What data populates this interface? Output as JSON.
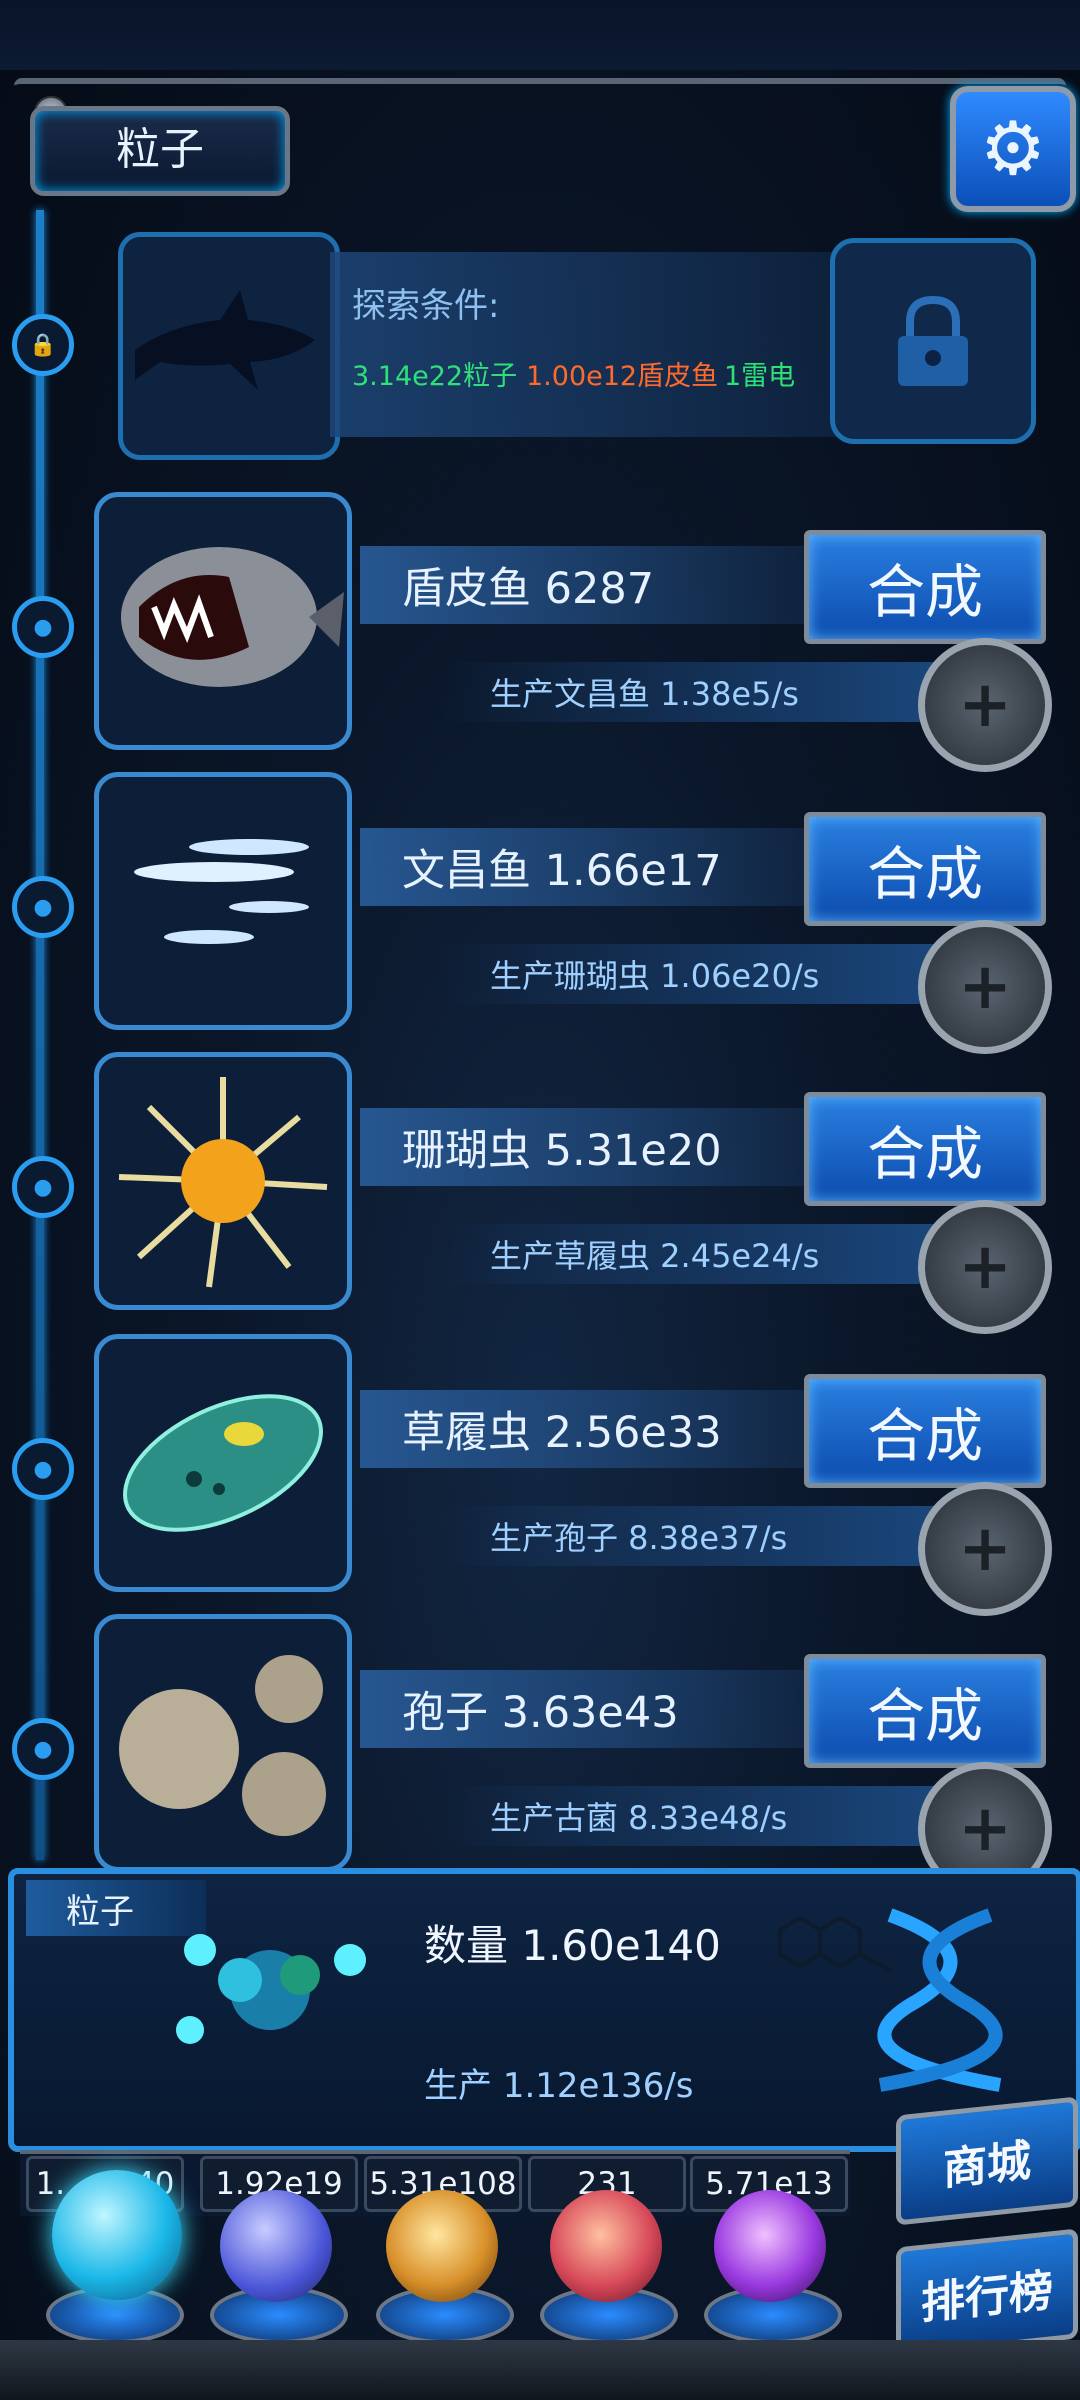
{
  "header": {
    "title": "粒子",
    "settings_icon": "gear-icon"
  },
  "locked": {
    "silhouette_icon": "shark-silhouette-icon",
    "condition_label": "探索条件:",
    "requirements": [
      {
        "text": "3.14e22粒子",
        "color": "#2ee07a"
      },
      {
        "text": "1.00e12盾皮鱼",
        "color": "#ff6a2b"
      },
      {
        "text": "1雷电",
        "color": "#2ee07a"
      }
    ],
    "lock_icon": "lock-icon"
  },
  "rows": [
    {
      "name": "盾皮鱼 6287",
      "production": "生产文昌鱼 1.38e5/s",
      "merge_label": "合成",
      "image": "armored-fish-icon"
    },
    {
      "name": "文昌鱼 1.66e17",
      "production": "生产珊瑚虫 1.06e20/s",
      "merge_label": "合成",
      "image": "lancelet-icon"
    },
    {
      "name": "珊瑚虫 5.31e20",
      "production": "生产草履虫 2.45e24/s",
      "merge_label": "合成",
      "image": "coral-polyp-icon"
    },
    {
      "name": "草履虫 2.56e33",
      "production": "生产孢子 8.38e37/s",
      "merge_label": "合成",
      "image": "paramecium-icon"
    },
    {
      "name": "孢子 3.63e43",
      "production": "生产古菌 8.33e48/s",
      "merge_label": "合成",
      "image": "spore-icon"
    }
  ],
  "summary": {
    "label": "粒子",
    "quantity": "数量 1.60e140",
    "production": "生产 1.12e136/s"
  },
  "resources": [
    {
      "value": "1.__e140",
      "orb_color": "#36d6ff"
    },
    {
      "value": "1.92e19",
      "orb_color": "#6b78ff"
    },
    {
      "value": "5.31e108",
      "orb_color": "#f0b040"
    },
    {
      "value": "231",
      "orb_color": "#ff5a6a"
    },
    {
      "value": "5.71e13",
      "orb_color": "#b050ff"
    }
  ],
  "side_buttons": {
    "shop": "商城",
    "ranking": "排行榜"
  }
}
